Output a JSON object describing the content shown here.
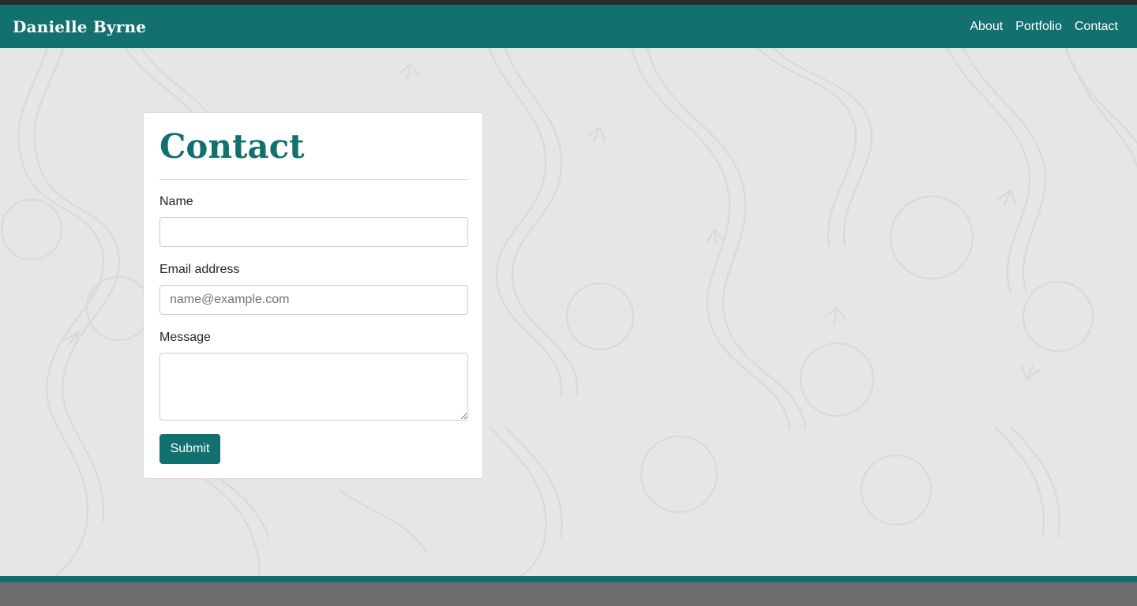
{
  "header": {
    "brand": "Danielle Byrne",
    "nav": [
      "About",
      "Portfolio",
      "Contact"
    ]
  },
  "contact": {
    "title": "Contact",
    "name_label": "Name",
    "name_value": "",
    "email_label": "Email address",
    "email_placeholder": "name@example.com",
    "email_value": "",
    "message_label": "Message",
    "message_value": "",
    "submit_label": "Submit"
  },
  "colors": {
    "accent": "#12706e",
    "page_background": "#e6e6e6",
    "footer": "#6d6d6d"
  }
}
